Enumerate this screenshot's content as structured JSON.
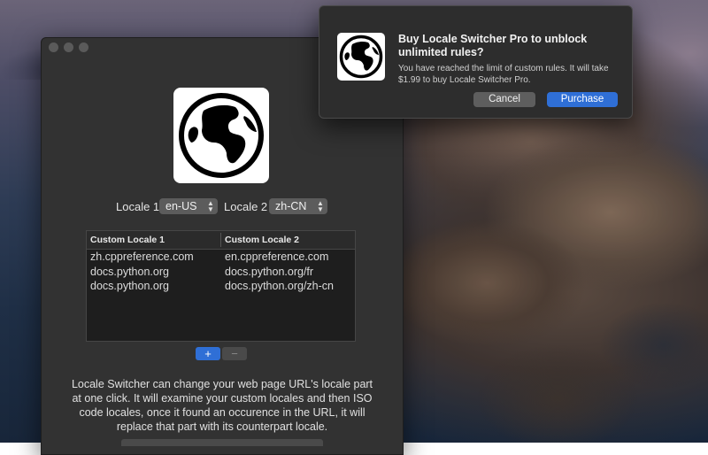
{
  "window": {
    "locale1_label": "Locale 1",
    "locale1_value": "en-US",
    "locale2_label": "Locale 2",
    "locale2_value": "zh-CN",
    "table": {
      "headers": [
        "Custom Locale 1",
        "Custom Locale 2"
      ],
      "rows": [
        [
          "zh.cppreference.com",
          "en.cppreference.com"
        ],
        [
          "docs.python.org",
          "docs.python.org/fr"
        ],
        [
          "docs.python.org",
          "docs.python.org/zh-cn"
        ]
      ]
    },
    "add_label": "+",
    "remove_label": "−",
    "description": "Locale Switcher can change your web page URL's locale part at one click. It will examine your custom locales and then ISO code locales, once it found an occurence in the URL, it will replace that part with its counterpart locale."
  },
  "alert": {
    "title": "Buy Locale Switcher Pro to unblock unlimited rules?",
    "message": "You have reached the limit of custom rules. It will take $1.99 to buy Locale Switcher Pro.",
    "cancel_label": "Cancel",
    "purchase_label": "Purchase"
  },
  "icons": {
    "app": "globe-icon",
    "select_arrows": "updown-chevron-icon"
  },
  "colors": {
    "accent": "#2f6fd6",
    "window_bg": "#323232",
    "alert_bg": "#2d2d2d"
  }
}
